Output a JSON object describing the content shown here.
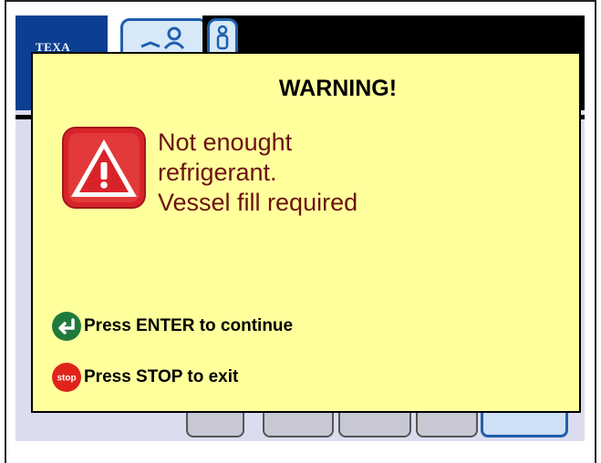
{
  "brand": {
    "logo_text": "TEXA"
  },
  "topbar": {
    "icons": [
      "people-icon",
      "person-icon"
    ]
  },
  "bottom_bar": {
    "buttons": [
      "button-1",
      "button-2",
      "button-3",
      "button-4",
      "button-5"
    ]
  },
  "dialog": {
    "title": "WARNING!",
    "icon": "warning-icon",
    "message": {
      "line1": "Not enought",
      "line2": "refrigerant.",
      "line3": "Vessel fill required"
    },
    "hints": {
      "enter": {
        "icon": "enter-icon",
        "text": "Press ENTER to continue"
      },
      "stop": {
        "icon": "stop-icon",
        "icon_label": "stop",
        "text": "Press STOP to exit"
      }
    }
  },
  "colors": {
    "dialog_bg": "#ffff9c",
    "message_text": "#6b1212",
    "warning_red": "#d9232a",
    "enter_green": "#1f7a3b",
    "stop_red": "#e0241c",
    "brand_blue": "#0c3e91"
  }
}
